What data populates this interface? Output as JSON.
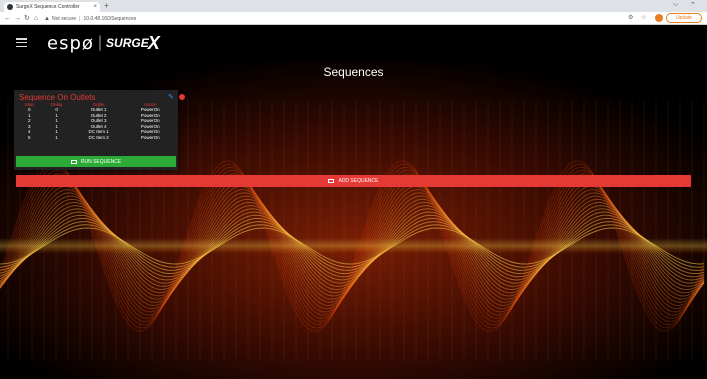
{
  "browser": {
    "tab_title": "SurgeX Sequence Controller",
    "tab_close": "×",
    "new_tab": "+",
    "url_security": "Not secure",
    "url_path": "10.0.48.160/Sequences",
    "update_label": "Update"
  },
  "header": {
    "logo_espo": "espø",
    "logo_sep": "|",
    "logo_surge": "SURGE",
    "logo_x": "X"
  },
  "page": {
    "title": "Sequences"
  },
  "card": {
    "title": "Sequence On Outlets",
    "columns": [
      "Step",
      "Delay",
      "Outlet",
      "Action"
    ],
    "rows": [
      [
        "0",
        "0",
        "Outlet 1",
        "PowerOn"
      ],
      [
        "1",
        "1",
        "Outlet 2",
        "PowerOn"
      ],
      [
        "2",
        "1",
        "Outlet 3",
        "PowerOn"
      ],
      [
        "3",
        "1",
        "Outlet 4",
        "PowerOn"
      ],
      [
        "4",
        "1",
        "DC Item 1",
        "PowerOn"
      ],
      [
        "5",
        "1",
        "DC Item 2",
        "PowerOn"
      ]
    ],
    "run_label": "RUN SEQUENCE"
  },
  "add_label": "ADD SEQUENCE",
  "colors": {
    "accent_red": "#e53935",
    "run_green": "#2bab36",
    "edit_blue": "#2196f3"
  }
}
